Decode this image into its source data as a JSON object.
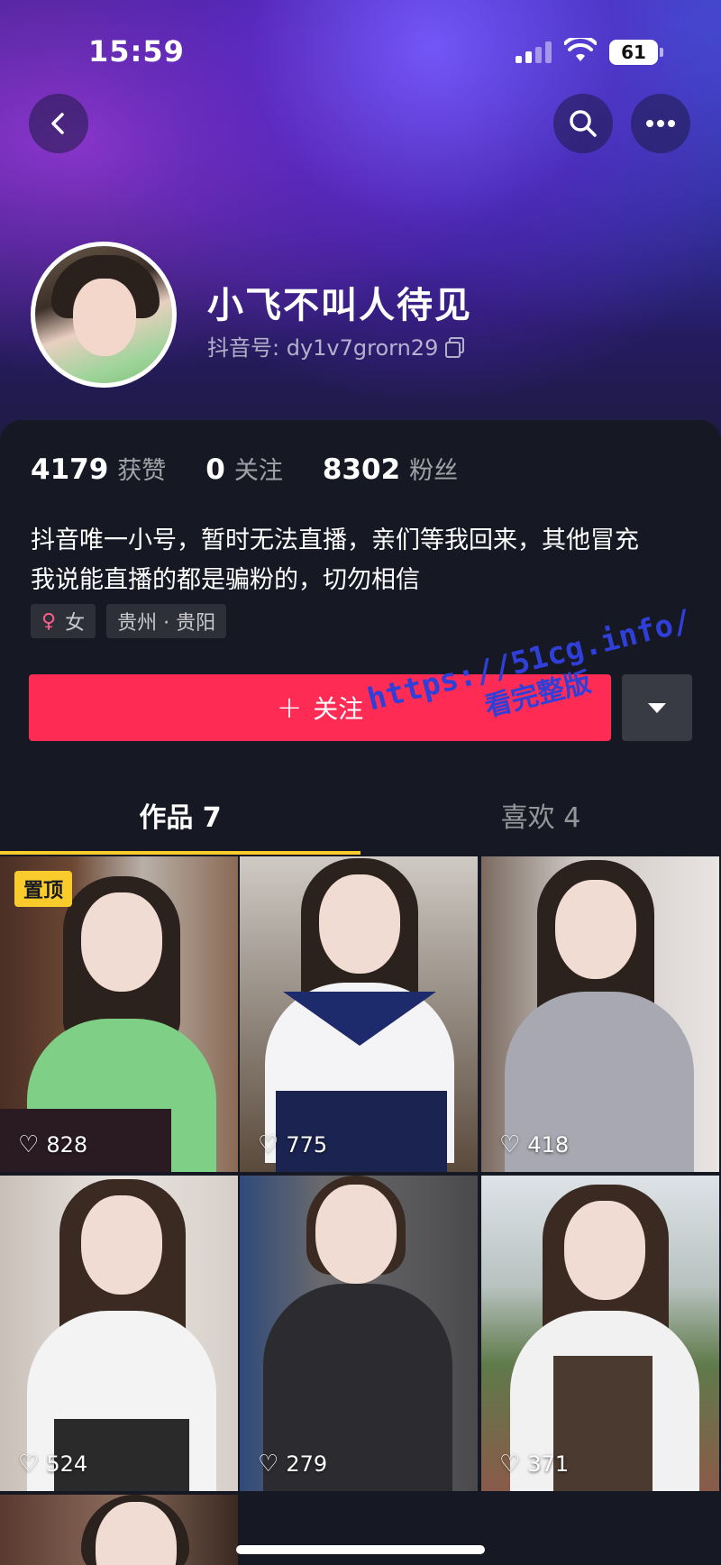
{
  "status_bar": {
    "time": "15:59",
    "battery": "61"
  },
  "profile": {
    "nickname": "小飞不叫人待见",
    "douyin_id": "抖音号: dy1v7grorn29",
    "stats": [
      {
        "value": "4179",
        "label": "获赞"
      },
      {
        "value": "0",
        "label": "关注"
      },
      {
        "value": "8302",
        "label": "粉丝"
      }
    ],
    "bio_lines": [
      "抖音唯一小号，暂时无法直播，亲们等我回来，其他冒充",
      "我说能直播的都是骗粉的，切勿相信"
    ],
    "tags": {
      "gender": "女",
      "location": "贵州 · 贵阳"
    }
  },
  "actions": {
    "follow_label": "关注",
    "follow_plus": "+"
  },
  "watermark": {
    "line1": "https://51cg.info/",
    "line2": "看完整版"
  },
  "tabs": [
    {
      "label": "作品 7",
      "active": true
    },
    {
      "label": "喜欢 4",
      "active": false
    }
  ],
  "videos": [
    {
      "likes": "828",
      "pinned_label": "置顶"
    },
    {
      "likes": "775"
    },
    {
      "likes": "418"
    },
    {
      "likes": "524"
    },
    {
      "likes": "279"
    },
    {
      "likes": "371"
    }
  ],
  "colors": {
    "accent": "#fe2c55",
    "tab_indicator": "#facc2b",
    "background": "#161823"
  }
}
